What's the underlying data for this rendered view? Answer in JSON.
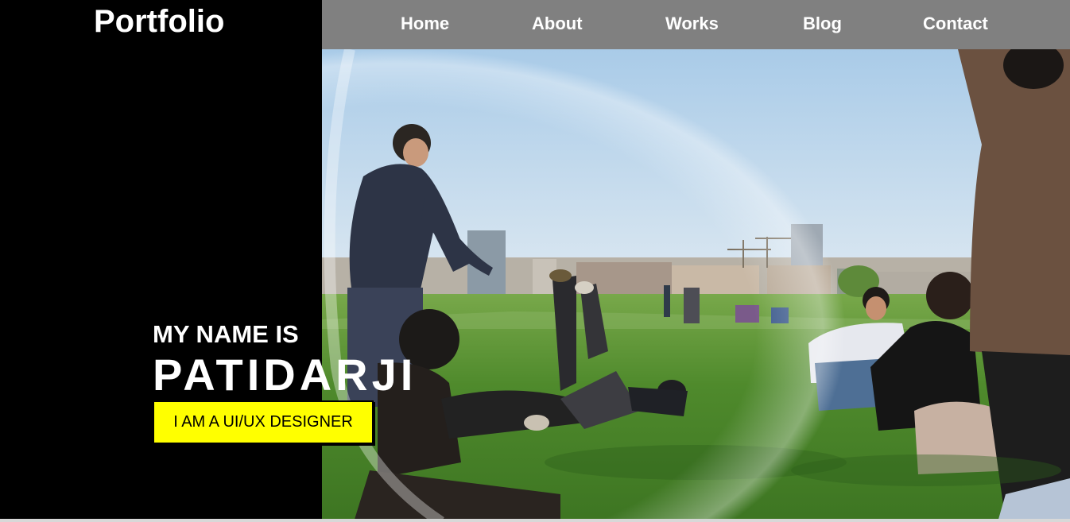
{
  "brand": {
    "logo_text": "Portfolio"
  },
  "nav": {
    "items": [
      {
        "label": "Home"
      },
      {
        "label": "About"
      },
      {
        "label": "Works"
      },
      {
        "label": "Blog"
      },
      {
        "label": "Contact"
      }
    ]
  },
  "hero": {
    "intro_line": "MY NAME IS",
    "name": "PATIDARJI",
    "role_badge": "I AM A UI/UX DESIGNER",
    "image_subject": "friends-relaxing-on-grass-in-park"
  },
  "colors": {
    "left_panel_bg": "#000000",
    "nav_bg": "#808080",
    "badge_bg": "#ffff00",
    "text_primary": "#ffffff"
  }
}
